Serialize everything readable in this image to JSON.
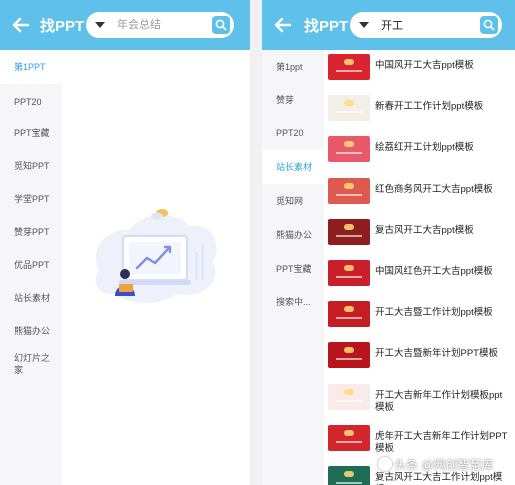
{
  "left": {
    "header": {
      "title": "找PPT",
      "search_placeholder": "年会总结",
      "search_value": ""
    },
    "sidebar": [
      {
        "label": "第1PPT",
        "active": true
      },
      {
        "label": "PPT20",
        "active": false
      },
      {
        "label": "PPT宝藏",
        "active": false
      },
      {
        "label": "觅知PPT",
        "active": false
      },
      {
        "label": "学堂PPT",
        "active": false
      },
      {
        "label": "赞芽PPT",
        "active": false
      },
      {
        "label": "优品PPT",
        "active": false
      },
      {
        "label": "站长素材",
        "active": false
      },
      {
        "label": "熊猫办公",
        "active": false
      },
      {
        "label": "幻灯片之家",
        "active": false
      }
    ]
  },
  "right": {
    "header": {
      "title": "找PPT",
      "search_value": "开工"
    },
    "sidebar": [
      {
        "label": "第1ppt",
        "active": false
      },
      {
        "label": "赞芽",
        "active": false
      },
      {
        "label": "PPT20",
        "active": false
      },
      {
        "label": "站长素材",
        "active": true
      },
      {
        "label": "觅知网",
        "active": false
      },
      {
        "label": "熊猫办公",
        "active": false
      },
      {
        "label": "PPT宝藏",
        "active": false
      },
      {
        "label": "搜索中...",
        "active": false
      }
    ],
    "results": [
      {
        "title": "中国风开工大吉ppt模板",
        "thumb_color": "#d9252f"
      },
      {
        "title": "新春开工工作计划ppt模板",
        "thumb_color": "#f4efe6"
      },
      {
        "title": "绘荔红开工计划ppt模板",
        "thumb_color": "#e85a6a"
      },
      {
        "title": "红色商务风开工大吉ppt模板",
        "thumb_color": "#e0594f"
      },
      {
        "title": "复古风开工大吉ppt模板",
        "thumb_color": "#8e1d1d"
      },
      {
        "title": "中国风红色开工大吉ppt模板",
        "thumb_color": "#c91f2a"
      },
      {
        "title": "开工大吉暨工作计划ppt模板",
        "thumb_color": "#c51d24"
      },
      {
        "title": "开工大吉暨新年计划PPT模板",
        "thumb_color": "#b9151c"
      },
      {
        "title": "开工大吉新年工作计划模板ppt模板",
        "thumb_color": "#fbeaea"
      },
      {
        "title": "虎年开工大吉新年工作计划PPT模板",
        "thumb_color": "#d2262c"
      },
      {
        "title": "复古风开工大吉工作计划ppt模板",
        "thumb_color": "#1f6b54"
      }
    ]
  },
  "watermark": "头条 @网创智慧库",
  "colors": {
    "header": "#5fc0ea",
    "active_tab": "#29a3d8",
    "sidebar_bg": "#f6f6f8"
  }
}
